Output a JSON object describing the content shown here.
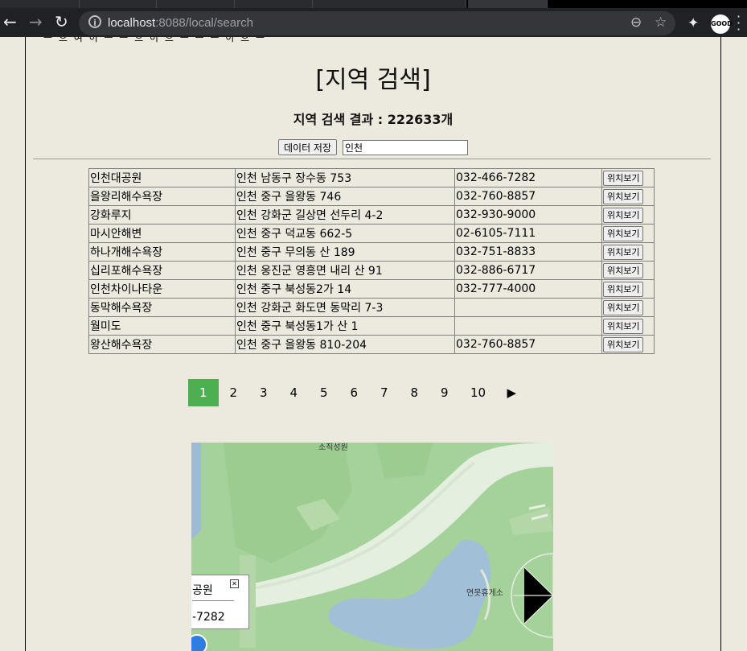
{
  "browser": {
    "url_host": "localhost",
    "url_rest": ":8088/local/search",
    "avatar_label": "GOOD"
  },
  "page": {
    "cut_text": "ㅡ 으 여 이 ㅡ ㅡ 으 이 으 ㅡ ㅡ ㅡ 이 으 ㅡ",
    "title": "[지역 검색]",
    "result_label": "지역 검색 결과 : 222633개",
    "save_button": "데이터 저장",
    "keyword_value": "인천",
    "locate_label": "위치보기"
  },
  "results": [
    {
      "name": "인천대공원",
      "address": "인천 남동구 장수동 753",
      "phone": "032-466-7282"
    },
    {
      "name": "을왕리해수욕장",
      "address": "인천 중구 을왕동 746",
      "phone": "032-760-8857"
    },
    {
      "name": "강화루지",
      "address": "인천 강화군 길상면 선두리 4-2",
      "phone": "032-930-9000"
    },
    {
      "name": "마시안해변",
      "address": "인천 중구 덕교동 662-5",
      "phone": "02-6105-7111"
    },
    {
      "name": "하나개해수욕장",
      "address": "인천 중구 무의동 산 189",
      "phone": "032-751-8833"
    },
    {
      "name": "십리포해수욕장",
      "address": "인천 옹진군 영흥면 내리 산 91",
      "phone": "032-886-6717"
    },
    {
      "name": "인천차이나타운",
      "address": "인천 중구 북성동2가 14",
      "phone": "032-777-4000"
    },
    {
      "name": "동막해수욕장",
      "address": "인천 강화군 화도면 동막리 7-3",
      "phone": ""
    },
    {
      "name": "월미도",
      "address": "인천 중구 북성동1가 산 1",
      "phone": ""
    },
    {
      "name": "왕산해수욕장",
      "address": "인천 중구 을왕동 810-204",
      "phone": "032-760-8857"
    }
  ],
  "pagination": {
    "pages": [
      "1",
      "2",
      "3",
      "4",
      "5",
      "6",
      "7",
      "8",
      "9",
      "10"
    ],
    "current": "1",
    "next": "▶"
  },
  "map": {
    "infowindow_title": "공원",
    "infowindow_phone": "-7282",
    "label_top": "소직성원",
    "label_rest": "연못휴게소"
  }
}
